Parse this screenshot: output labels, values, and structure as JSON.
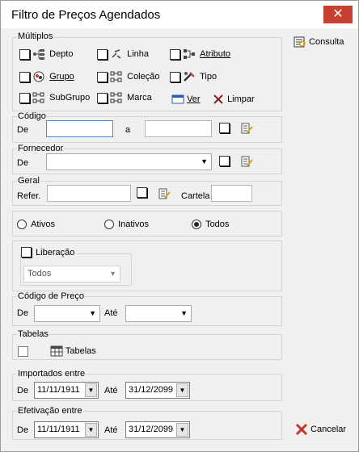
{
  "window": {
    "title": "Filtro de Preços Agendados",
    "close_glyph": "✕"
  },
  "multiplos": {
    "legend": "Múltiplos",
    "items": [
      {
        "label": "Depto",
        "icon": "department-tree-icon"
      },
      {
        "label": "Linha",
        "icon": "line-link-icon"
      },
      {
        "label": "Atributo",
        "icon": "attribute-tree-icon"
      },
      {
        "label": "Grupo",
        "icon": "group-circle-icon"
      },
      {
        "label": "Coleção",
        "icon": "collection-grid-icon"
      },
      {
        "label": "Tipo",
        "icon": "type-tools-icon"
      },
      {
        "label": "SubGrupo",
        "icon": "subgroup-grid-icon"
      },
      {
        "label": "Marca",
        "icon": "brand-grid-icon"
      }
    ],
    "ver_label": "Ver",
    "limpar_label": "Limpar"
  },
  "codigo": {
    "legend": "Código",
    "de_label": "De",
    "a_label": "a",
    "de_value": "",
    "a_value": ""
  },
  "fornecedor": {
    "legend": "Fornecedor",
    "de_label": "De",
    "value": ""
  },
  "geral": {
    "legend": "Geral",
    "refer_label": "Refer.",
    "cartela_label": "Cartela",
    "refer_value": "",
    "cartela_value": ""
  },
  "status": {
    "options": [
      "Ativos",
      "Inativos",
      "Todos"
    ],
    "selected": "Todos"
  },
  "liberacao": {
    "legend": "Liberação",
    "value": "Todos"
  },
  "codigo_preco": {
    "legend": "Código de Preço",
    "de_label": "De",
    "ate_label": "Até",
    "de_value": "",
    "ate_value": ""
  },
  "tabelas": {
    "legend": "Tabelas",
    "button_label": "Tabelas"
  },
  "importados": {
    "legend": "Importados entre",
    "de_label": "De",
    "ate_label": "Até",
    "de_value": "11/11/1911",
    "ate_value": "31/12/2099"
  },
  "efetivacao": {
    "legend": "Efetivação entre",
    "de_label": "De",
    "ate_label": "Até",
    "de_value": "11/11/1911",
    "ate_value": "31/12/2099"
  },
  "side": {
    "consulta_label": "Consulta",
    "cancelar_label": "Cancelar"
  },
  "colors": {
    "close_red": "#c84031",
    "focus_blue": "#3c8fd6",
    "cancel_red": "#c0392b"
  }
}
